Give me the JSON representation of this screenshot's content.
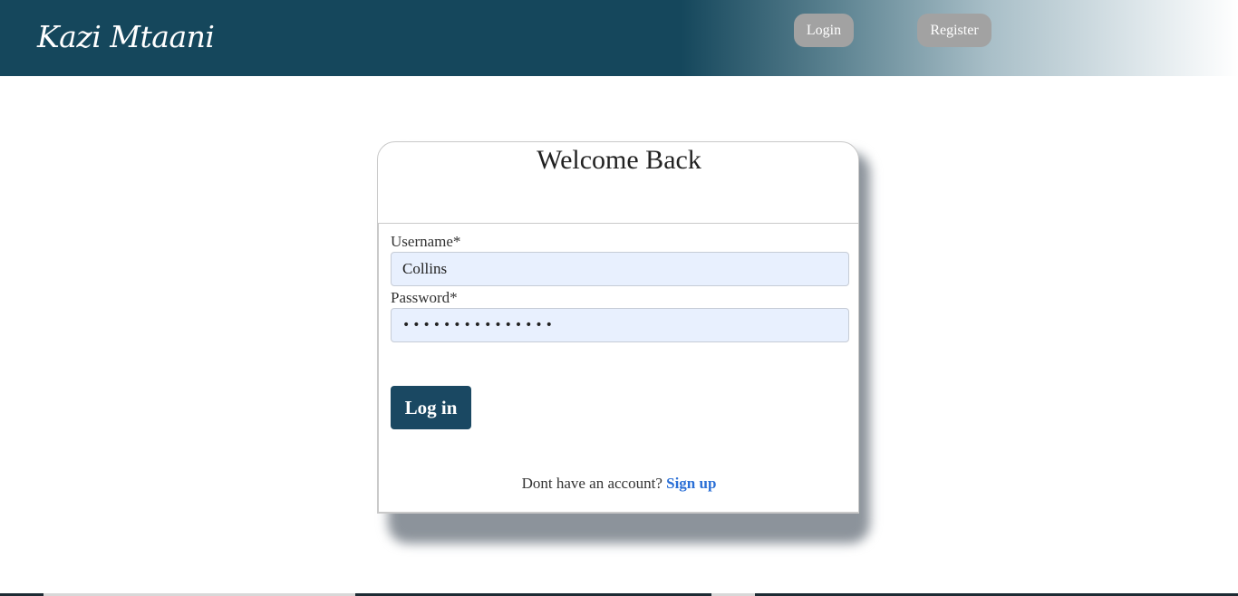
{
  "header": {
    "brand": "Kazi Mtaani",
    "nav": {
      "login_label": "Login",
      "register_label": "Register"
    }
  },
  "login_card": {
    "title": "Welcome Back",
    "username": {
      "label": "Username*",
      "value": "Collins"
    },
    "password": {
      "label": "Password*",
      "masked_value": "•••••••••••••••"
    },
    "submit_label": "Log in",
    "signup_prompt": "Dont have an account?",
    "signup_link": "Sign up"
  },
  "colors": {
    "header_bg": "#15475c",
    "nav_button_bg": "#a2a2a2",
    "input_bg": "#e8f0fe",
    "primary_button": "#1a4862",
    "link": "#2a6fd6"
  }
}
